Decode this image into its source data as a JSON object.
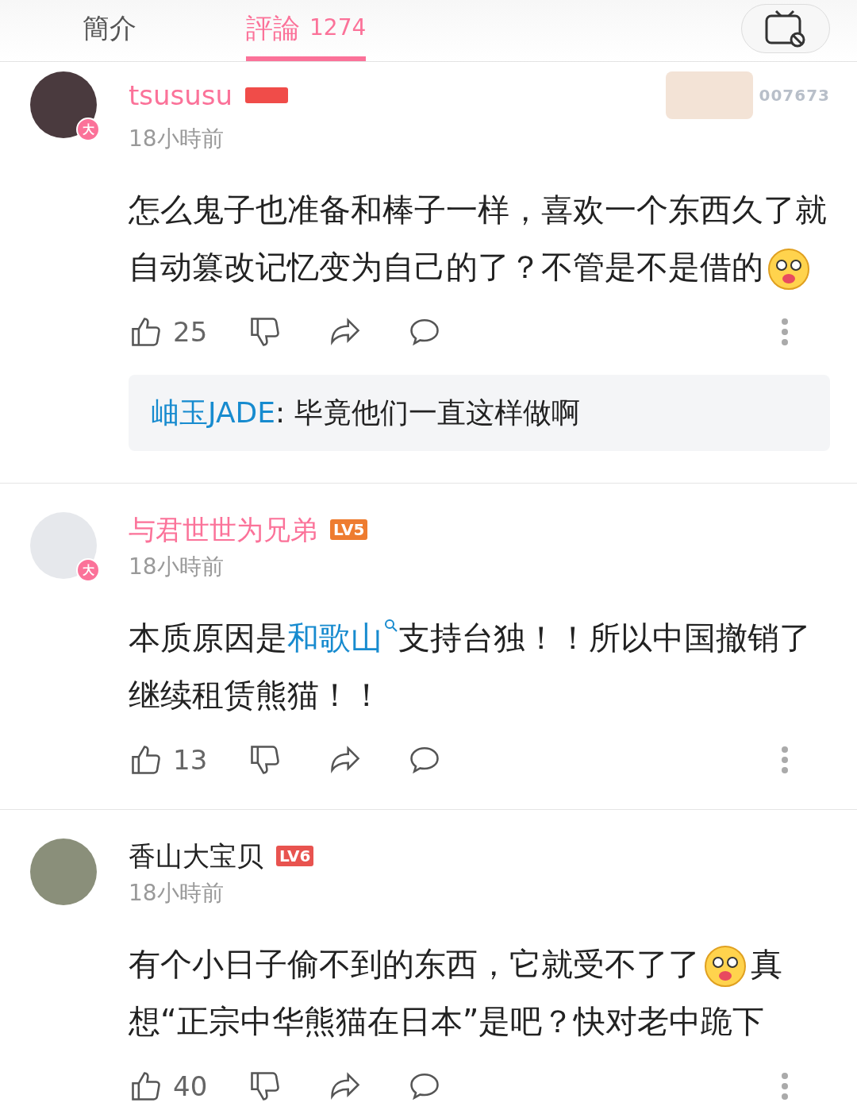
{
  "tabs": [
    {
      "label": "簡介",
      "selected": false
    },
    {
      "label": "評論",
      "count": "1274",
      "selected": true
    }
  ],
  "comments": [
    {
      "user": "tsususu",
      "vip": true,
      "avatar_badge": "大",
      "fan_number": "007673",
      "time": "18小時前",
      "body": [
        {
          "kind": "text",
          "text": "怎么鬼子也准备和棒子一样，喜欢一个东西久了就自动篡改记忆变为自己的了？不管是不是借的"
        },
        {
          "kind": "emoji"
        }
      ],
      "likes": "25",
      "replies": [
        {
          "user": "岫玉JADE",
          "text": ": 毕竟他们一直这样做啊"
        }
      ]
    },
    {
      "user": "与君世世为兄弟",
      "vip": true,
      "avatar_badge": "大",
      "level": "LV5",
      "time": "18小時前",
      "body": [
        {
          "kind": "text",
          "text": "本质原因是"
        },
        {
          "kind": "link",
          "text": "和歌山"
        },
        {
          "kind": "text",
          "text": "支持台独！！所以中国撤销了继续租赁熊猫！！"
        }
      ],
      "likes": "13"
    },
    {
      "user": "香山大宝贝",
      "vip": false,
      "level": "LV6",
      "time": "18小時前",
      "body": [
        {
          "kind": "text",
          "text": "有个小日子偷不到的东西，它就受不了了"
        },
        {
          "kind": "emoji"
        },
        {
          "kind": "text",
          "text": "真想“正宗中华熊猫在日本”是吧？快对老中跪下"
        }
      ],
      "likes": "40"
    }
  ]
}
